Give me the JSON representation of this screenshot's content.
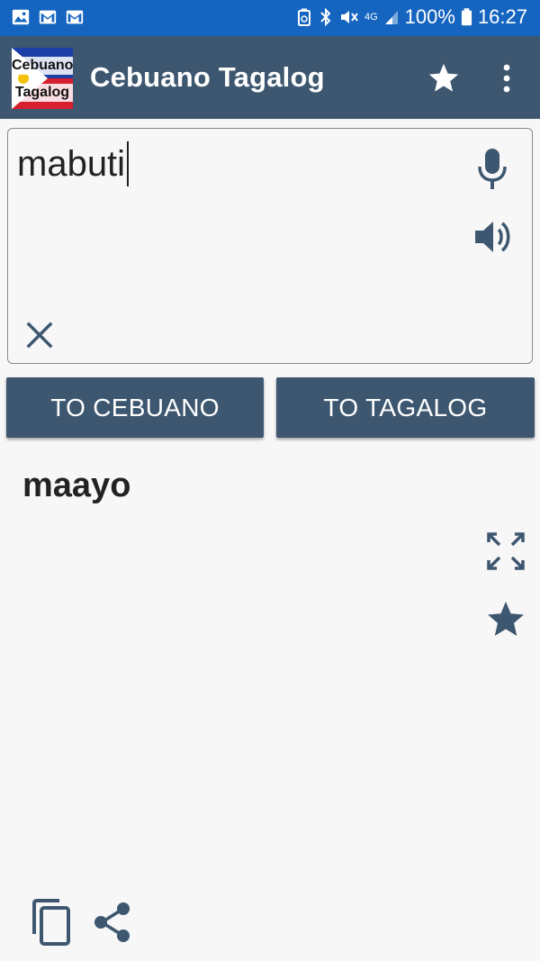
{
  "status_bar": {
    "battery": "100%",
    "network": "4G",
    "time": "16:27",
    "color": "#1565c0"
  },
  "app_bar": {
    "title": "Cebuano Tagalog",
    "logo_line1": "Cebuano",
    "logo_line2": "Tagalog",
    "color": "#3e5770"
  },
  "input": {
    "value": "mabuti"
  },
  "buttons": {
    "to_cebuano": "TO CEBUANO",
    "to_tagalog": "TO TAGALOG"
  },
  "result": {
    "text": "maayo"
  },
  "icons": {
    "app_bar": [
      "star-icon",
      "overflow-menu-icon"
    ],
    "input": [
      "microphone-icon",
      "speaker-icon",
      "clear-icon"
    ],
    "result": [
      "expand-icon",
      "favorite-star-icon"
    ],
    "bottom": [
      "copy-icon",
      "share-icon"
    ]
  }
}
